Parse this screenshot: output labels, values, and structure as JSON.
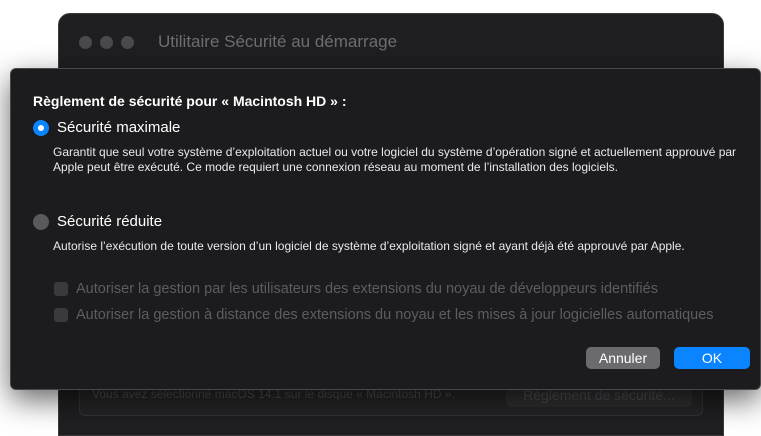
{
  "window": {
    "title": "Utilitaire Sécurité au démarrage"
  },
  "background_panel": {
    "text": "Vous avez sélectionné macOS 14.1 sur le disque « Macintosh HD ».",
    "button_label": "Règlement de sécurité..."
  },
  "dialog": {
    "title": "Règlement de sécurité pour « Macintosh HD » :",
    "options": [
      {
        "label": "Sécurité maximale",
        "selected": true,
        "description": "Garantit que seul votre système d’exploitation actuel ou votre logiciel du système d’opération signé et actuellement approuvé par Apple peut être exécuté. Ce mode requiert une connexion réseau au moment de l’installation des logiciels."
      },
      {
        "label": "Sécurité réduite",
        "selected": false,
        "description": "Autorise l’exécution de toute version d’un logiciel de système d’exploitation signé et ayant déjà été approuvé par Apple."
      }
    ],
    "checkboxes": [
      {
        "label": "Autoriser la gestion par les utilisateurs des extensions du noyau de développeurs identifiés",
        "checked": false,
        "enabled": false
      },
      {
        "label": "Autoriser la gestion à distance des extensions du noyau et les mises à jour logicielles automatiques",
        "checked": false,
        "enabled": false
      }
    ],
    "cancel_label": "Annuler",
    "ok_label": "OK"
  },
  "colors": {
    "accent": "#0a84ff",
    "dialog_background": "#1c1c1e",
    "window_background": "#1f1f21"
  }
}
